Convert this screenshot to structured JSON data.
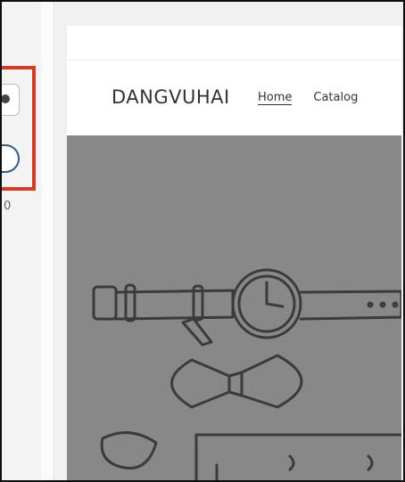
{
  "left_panel": {
    "partial_value": "0"
  },
  "site": {
    "logo": "DANGVUHAI",
    "nav": [
      {
        "label": "Home"
      },
      {
        "label": "Catalog"
      }
    ]
  },
  "colors": {
    "highlight_border": "#d63a22",
    "hero_bg": "#888888",
    "radio_border": "#2f5d8a"
  },
  "icons": [
    "wristwatch-illustration",
    "bow-tie-illustration",
    "sunglasses-illustration",
    "box-illustration"
  ]
}
